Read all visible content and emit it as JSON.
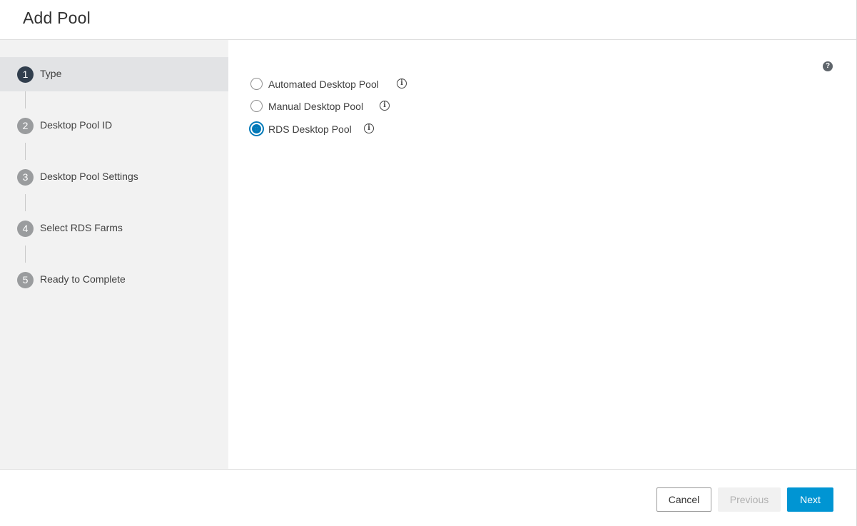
{
  "dialog": {
    "title": "Add Pool"
  },
  "steps": [
    {
      "number": "1",
      "label": "Type",
      "active": true
    },
    {
      "number": "2",
      "label": "Desktop Pool ID",
      "active": false
    },
    {
      "number": "3",
      "label": "Desktop Pool Settings",
      "active": false
    },
    {
      "number": "4",
      "label": "Select RDS Farms",
      "active": false
    },
    {
      "number": "5",
      "label": "Ready to Complete",
      "active": false
    }
  ],
  "pool_types": {
    "selected": "RDS Desktop Pool",
    "options": [
      {
        "label": "Automated Desktop Pool",
        "checked": false
      },
      {
        "label": "Manual Desktop Pool",
        "checked": false
      },
      {
        "label": "RDS Desktop Pool",
        "checked": true
      }
    ]
  },
  "icons": {
    "help": "question-circle-icon",
    "info": "info-circle-icon",
    "help_glyph": "?",
    "info_glyph": "i"
  },
  "footer": {
    "cancel_label": "Cancel",
    "previous_label": "Previous",
    "next_label": "Next"
  },
  "colors": {
    "accent": "#0079b8",
    "primary_button": "#0095d3",
    "active_step": "#313e4d",
    "inactive_step": "#9a9c9e",
    "sidebar_bg": "#f2f2f2"
  }
}
